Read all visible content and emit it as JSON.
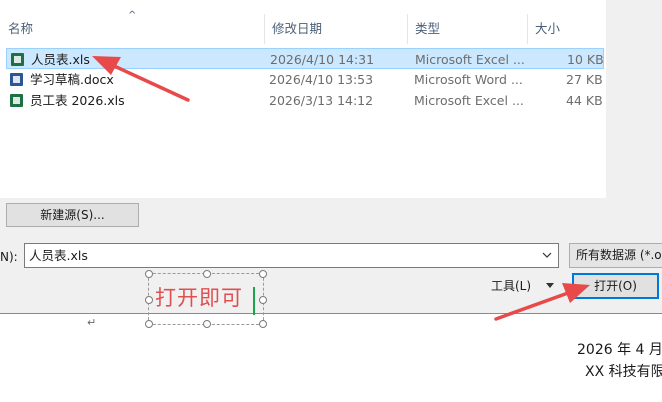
{
  "file_list": {
    "columns": {
      "name": "名称",
      "date": "修改日期",
      "type": "类型",
      "size": "大小"
    },
    "sort_indicator": "^",
    "rows": [
      {
        "icon": "excel-file-icon",
        "name": "人员表.xls",
        "date": "2026/4/10 14:31",
        "type": "Microsoft Excel ...",
        "size": "10 KB",
        "selected": true
      },
      {
        "icon": "word-file-icon",
        "name": "学习草稿.docx",
        "date": "2026/4/10 13:53",
        "type": "Microsoft Word ...",
        "size": "27 KB",
        "selected": false
      },
      {
        "icon": "excel-file-icon",
        "name": "员工表 2026.xls",
        "date": "2026/3/13 14:12",
        "type": "Microsoft Excel ...",
        "size": "44 KB",
        "selected": false
      }
    ]
  },
  "dialog": {
    "new_source_label": "新建源(S)...",
    "filename_label": "N):",
    "filename_value": "人员表.xls",
    "filetype_value": "所有数据源 (*.odc",
    "tools_label": "工具(L)",
    "open_label": "打开(O)"
  },
  "annotation": {
    "text": "打开即可",
    "color": "#e05050"
  },
  "document": {
    "date_text": "2026 年 4 月",
    "company_text": "XX 科技有限"
  },
  "colors": {
    "selection_bg": "#cce8ff",
    "accent_border": "#0078d7",
    "arrow": "#e84a4a"
  }
}
